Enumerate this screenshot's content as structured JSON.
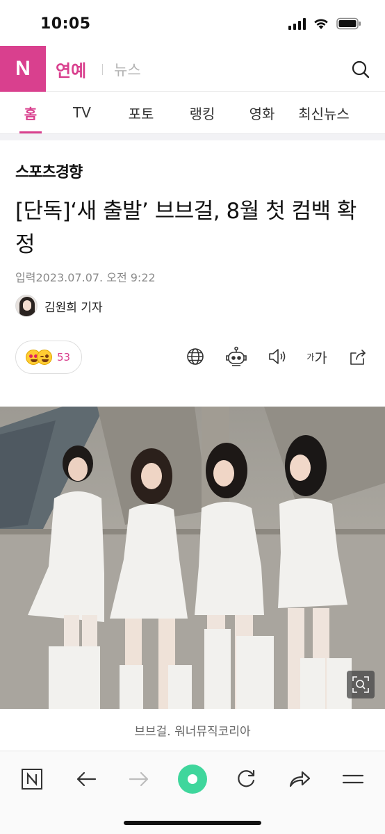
{
  "status_bar": {
    "time": "10:05",
    "icons": [
      "cellular-signal-icon",
      "wifi-icon",
      "battery-icon"
    ]
  },
  "header": {
    "logo_letter": "N",
    "section": "연예",
    "subsection": "뉴스",
    "search_icon": "search-icon",
    "accent_color": "#d9408e"
  },
  "tabs": [
    {
      "label": "홈",
      "active": true
    },
    {
      "label": "TV",
      "active": false
    },
    {
      "label": "포토",
      "active": false
    },
    {
      "label": "랭킹",
      "active": false
    },
    {
      "label": "영화",
      "active": false
    },
    {
      "label": "최신뉴스",
      "active": false
    }
  ],
  "article": {
    "publisher": "스포츠경향",
    "headline": "[단독]‘새 출발’ 브브걸, 8월 첫 컴백 확정",
    "date": "입력2023.07.07. 오전 9:22",
    "reporter": "김원희 기자",
    "reaction_count": "53",
    "tools": {
      "font_small": "가",
      "font_large": "가",
      "icons": [
        "globe-icon",
        "robot-icon",
        "speaker-icon",
        "font-size-icon",
        "share-icon"
      ]
    },
    "caption": "브브걸. 워너뮤직코리아"
  },
  "bottom_bar": {
    "icons": [
      "naver-home-icon",
      "back-arrow-icon",
      "forward-arrow-icon",
      "green-dot-icon",
      "refresh-icon",
      "share-arrow-icon",
      "menu-icon"
    ],
    "green_color": "#3fd69c"
  }
}
